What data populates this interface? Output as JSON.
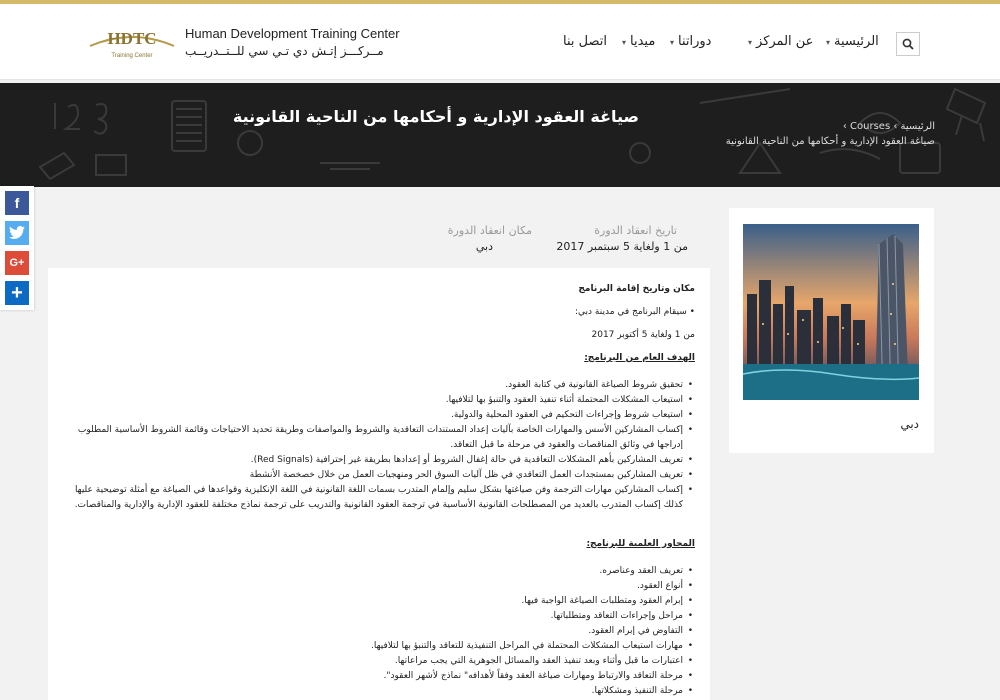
{
  "header": {
    "logo_mark": "HDTC",
    "logo_sub": "Training Center",
    "logo_en": "Human Development Training Center",
    "logo_ar": "مــركـــز إتـش دي تـي سي للــتــدريــب",
    "nav": [
      {
        "label": "الرئيسية",
        "has_dropdown": true
      },
      {
        "label": "عن المركز",
        "has_dropdown": true
      },
      {
        "label": "دوراتنا",
        "has_dropdown": true
      },
      {
        "label": "ميديا",
        "has_dropdown": true
      },
      {
        "label": "اتصل بنا",
        "has_dropdown": false
      }
    ],
    "search_icon": "search-icon"
  },
  "hero": {
    "title": "صياغة العقود الإدارية و أحكامها من الناحية القانونية",
    "breadcrumb_home": "الرئيسية",
    "breadcrumb_sep": "›",
    "breadcrumb_courses": "Courses",
    "breadcrumb_current": "صياغة العقود الإدارية و أحكامها من الناحية القانونية"
  },
  "share": {
    "facebook": "f",
    "twitter": "t",
    "google": "G+",
    "more": "+"
  },
  "sidebar": {
    "caption": "دبي"
  },
  "course_info": {
    "date_label": "تاريخ انعقاد الدورة",
    "date_value": "من 1 ولغاية 5 سبتمبر 2017",
    "place_label": "مكان انعقاد الدورة",
    "place_value": "دبي"
  },
  "content": {
    "venue_heading": "مكان وتاريخ إقامة البرنامج",
    "venue_line": "• سيقام البرنامج في مدينة دبي:",
    "venue_date": "من 1 ولغاية 5 أكتوبر 2017",
    "goal_heading": "الهدف العام من البرنامج:",
    "goals": [
      "تحقيق شروط الصياغة القانونية في كتابة العقود.",
      "استيعاب المشكلات المحتملة أثناء تنفيذ العقود والتنبؤ بها لتلافيها.",
      "استيعاب شروط وإجراءات التحكيم في العقود المحلية والدولية.",
      "إكساب المشاركين الأسس والمهارات الخاصة بآليات إعداد المستندات التعاقدية والشروط والمواصفات وطريقة تحديد الاحتياجات وقائمة الشروط الأساسية المطلوب إدراجها في وثائق المناقصات والعقود في مرحلة ما قبل التعاقد.",
      "تعريف المشاركين بأهم المشكلات التعاقدية في حالة إغفال الشروط أو إعدادها بطريقة غير إحترافية (Red Signals).",
      "تعريف المشاركين بمستجدات العمل التعاقدي في ظل آليات السوق الحر ومنهجيات العمل من خلال خصخصة الأنشطة",
      "إكساب المشاركين مهارات الترجمة وفن صياغتها بشكل سليم وإلمام المتدرب بسمات اللغة القانونية في اللغة الإنكليزية وقواعدها في الصياغة مع أمثلة توضيحية عليها كذلك إكساب المتدرب بالعديد من المصطلحات القانونية الأساسية في ترجمة العقود القانونية والتدريب على ترجمة نماذج مختلفة للعقود الإدارية والإدارية والمناقصات."
    ],
    "axes_heading": "المحاور العلمية للبرنامج:",
    "axes": [
      "تعريف العقد وعناصره.",
      "أنواع العقود.",
      "إبرام العقود ومتطلبات الصياغة الواجبة فيها.",
      "مراحل وإجراءات التعاقد ومتطلباتها.",
      "التفاوض في إبرام العقود.",
      "مهارات استيعاب المشكلات المحتملة في المراحل التنفيذية للتعاقد والتنبؤ بها لتلافيها.",
      "اعتبارات ما قبل وأثناء وبعد تنفيذ العقد والمسائل الجوهرية التي يجب مراعاتها.",
      "مرحلة التعاقد والارتباط ومهارات صياغة العقد وفقاً لأهدافه\" نماذج لأشهر العقود\".",
      "مرحلة التنفيذ ومشكلاتها."
    ]
  }
}
